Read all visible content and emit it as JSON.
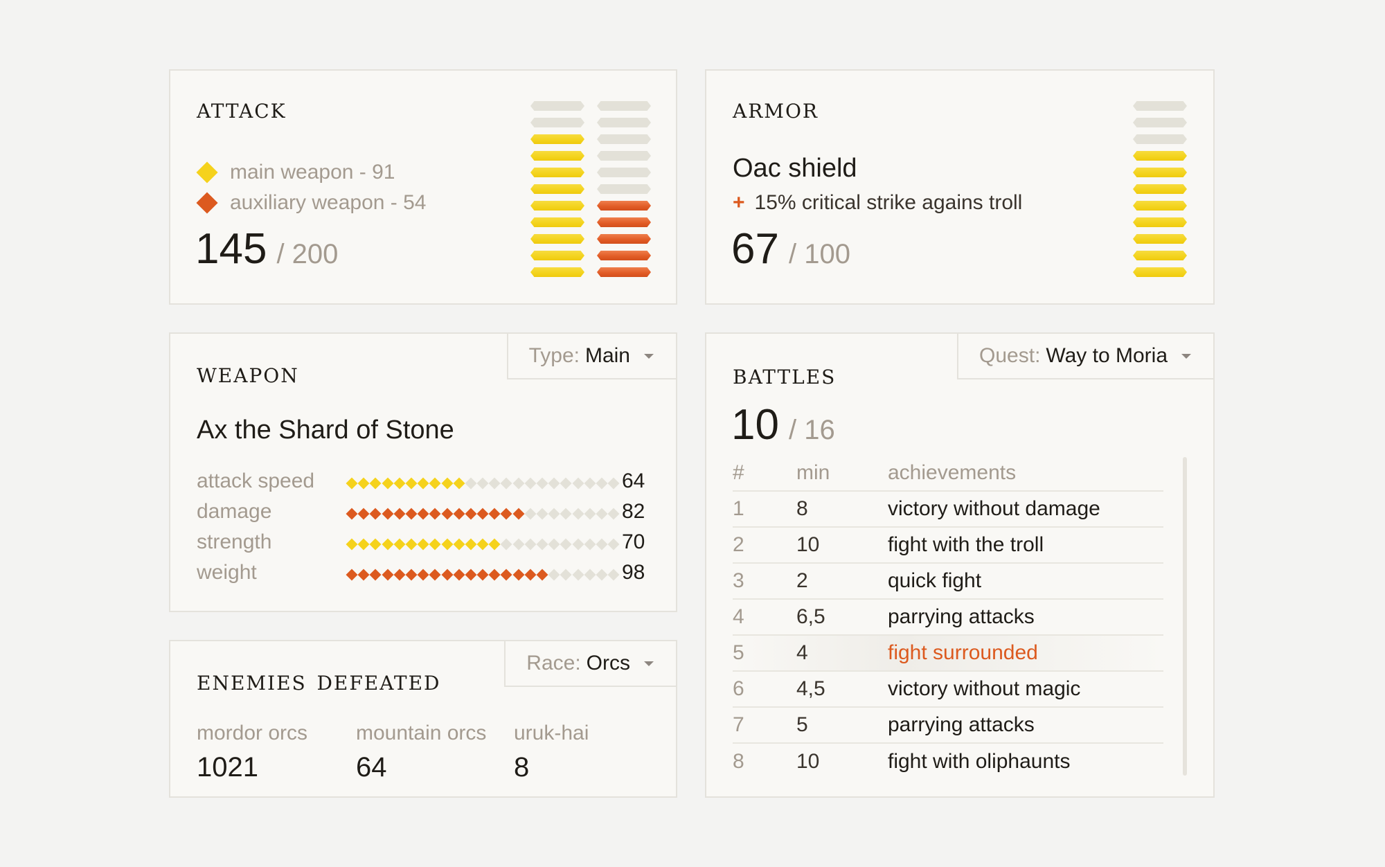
{
  "attack": {
    "title": "attack",
    "legend": [
      {
        "label": "main weapon - 91",
        "color": "#f5d21c"
      },
      {
        "label": "auxiliary weapon - 54",
        "color": "#dc5a1f"
      }
    ],
    "value": "145",
    "max": "/ 200",
    "main_filled": 9,
    "aux_filled": 5,
    "segments": 11
  },
  "armor": {
    "title": "armor",
    "item": "Oac shield",
    "bonus_icon": "+",
    "bonus": "15% critical strike agains troll",
    "value": "67",
    "max": "/ 100",
    "filled": 8,
    "segments": 11
  },
  "weapon": {
    "title": "weapon",
    "dropdown": {
      "key": "Type:",
      "value": "Main"
    },
    "name": "Ax the Shard of Stone",
    "stats": [
      {
        "label": "attack speed",
        "value": "64",
        "filled": 10,
        "color": "yellow"
      },
      {
        "label": "damage",
        "value": "82",
        "filled": 15,
        "color": "orange"
      },
      {
        "label": "strength",
        "value": "70",
        "filled": 13,
        "color": "yellow"
      },
      {
        "label": "weight",
        "value": "98",
        "filled": 17,
        "color": "orange"
      }
    ]
  },
  "enemies": {
    "title": "enemies defeated",
    "dropdown": {
      "key": "Race:",
      "value": "Orcs"
    },
    "groups": [
      {
        "label": "mordor orcs",
        "value": "1021"
      },
      {
        "label": "mountain orcs",
        "value": "64"
      },
      {
        "label": "uruk-hai",
        "value": "8"
      }
    ]
  },
  "battles": {
    "title": "battles",
    "dropdown": {
      "key": "Quest:",
      "value": "Way to Moria"
    },
    "value": "10",
    "max": "/ 16",
    "columns": [
      "#",
      "min",
      "achievements"
    ],
    "rows": [
      {
        "n": "1",
        "min": "8",
        "ach": "victory without damage"
      },
      {
        "n": "2",
        "min": "10",
        "ach": "fight with the troll"
      },
      {
        "n": "3",
        "min": "2",
        "ach": "quick fight"
      },
      {
        "n": "4",
        "min": "6,5",
        "ach": "parrying attacks"
      },
      {
        "n": "5",
        "min": "4",
        "ach": "fight surrounded"
      },
      {
        "n": "6",
        "min": "4,5",
        "ach": "victory without magic"
      },
      {
        "n": "7",
        "min": "5",
        "ach": "parrying attacks"
      },
      {
        "n": "8",
        "min": "10",
        "ach": "fight with oliphaunts"
      }
    ],
    "highlighted_row": 4
  },
  "colors": {
    "yellow": "#f5d21c",
    "orange": "#dc5a1f",
    "empty": "#e3e1d8"
  }
}
